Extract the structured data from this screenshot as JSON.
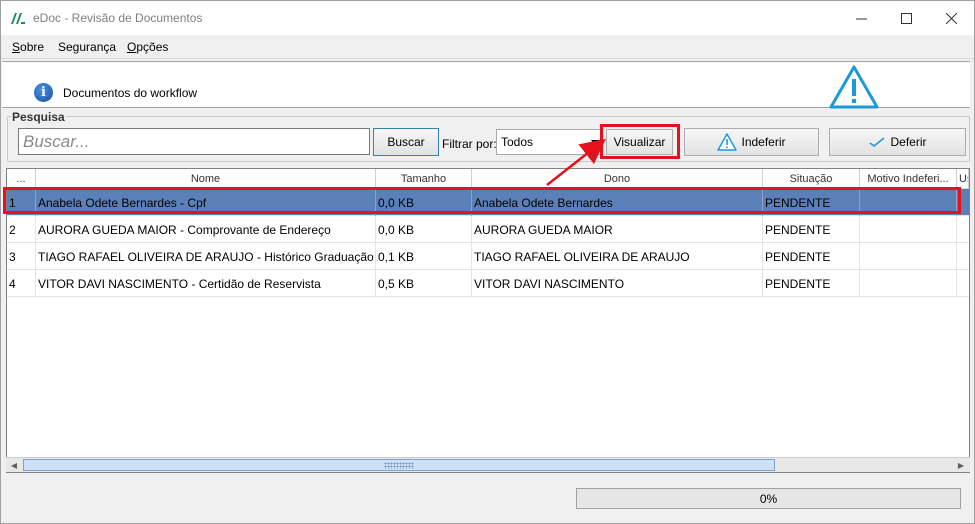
{
  "window": {
    "title": "eDoc - Revisão de Documentos"
  },
  "menu": [
    {
      "label": "Sobre",
      "accel": "S",
      "rest": "obre"
    },
    {
      "label": "Segurança",
      "accel": "",
      "rest": "Segurança"
    },
    {
      "label": "Opções",
      "accel": "O",
      "rest": "pções"
    }
  ],
  "header": {
    "label": "Documentos do workflow",
    "info_icon": "info-icon",
    "warning_icon": "warning-icon"
  },
  "search": {
    "group_title": "Pesquisa",
    "placeholder": "Buscar...",
    "value": "",
    "search_button": "Buscar",
    "filter_label": "Filtrar por:",
    "filter_value": "Todos",
    "view_button": "Visualizar",
    "reject_button": "Indeferir",
    "approve_button": "Deferir"
  },
  "table": {
    "columns": [
      "...",
      "Nome",
      "Tamanho",
      "Dono",
      "Situação",
      "Motivo Indeferi...",
      "Us"
    ],
    "rows": [
      {
        "num": "1",
        "nome": "Anabela Odete Bernardes - Cpf",
        "tamanho": "0,0 KB",
        "dono": "Anabela Odete Bernardes",
        "situacao": "PENDENTE",
        "motivo": ""
      },
      {
        "num": "2",
        "nome": "AURORA GUEDA MAIOR - Comprovante de Endereço",
        "tamanho": "0,0 KB",
        "dono": "AURORA GUEDA MAIOR",
        "situacao": "PENDENTE",
        "motivo": ""
      },
      {
        "num": "3",
        "nome": "TIAGO RAFAEL OLIVEIRA DE ARAUJO - Histórico Graduação",
        "tamanho": "0,1 KB",
        "dono": "TIAGO RAFAEL OLIVEIRA DE ARAUJO",
        "situacao": "PENDENTE",
        "motivo": ""
      },
      {
        "num": "4",
        "nome": "VITOR DAVI NASCIMENTO - Certidão de Reservista",
        "tamanho": "0,5 KB",
        "dono": "VITOR DAVI NASCIMENTO",
        "situacao": "PENDENTE",
        "motivo": ""
      }
    ],
    "selected_row": 0
  },
  "progress": {
    "value": 0,
    "label": "0%"
  },
  "colors": {
    "selection": "#5b7fb7",
    "annotation": "#e8101a",
    "accent_blue": "#1a9ad6"
  }
}
